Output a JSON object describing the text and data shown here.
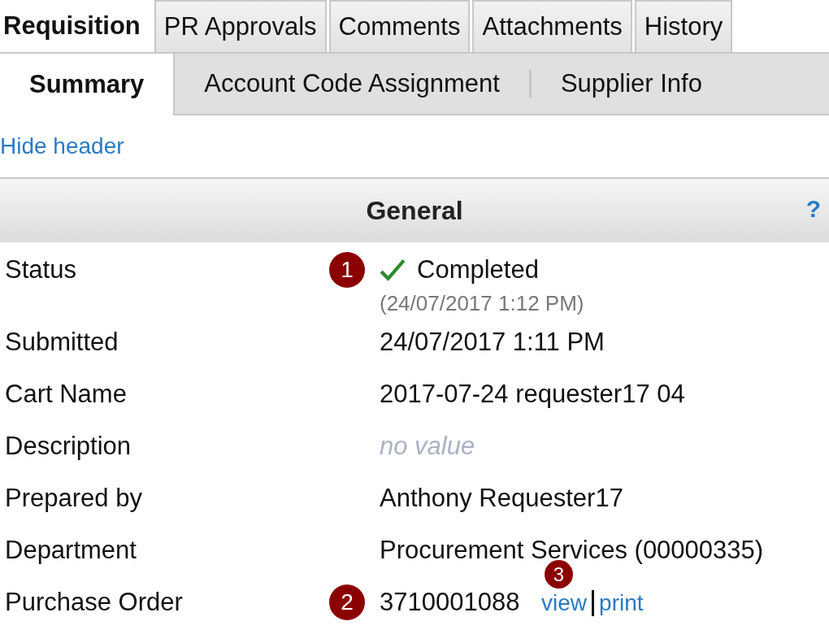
{
  "tabs": [
    {
      "label": "Requisition",
      "selected": true
    },
    {
      "label": "PR Approvals",
      "selected": false
    },
    {
      "label": "Comments",
      "selected": false
    },
    {
      "label": "Attachments",
      "selected": false
    },
    {
      "label": "History",
      "selected": false
    }
  ],
  "subtabs": [
    {
      "label": "Summary",
      "selected": true
    },
    {
      "label": "Account Code Assignment",
      "selected": false
    },
    {
      "label": "Supplier Info",
      "selected": false
    }
  ],
  "hide_header": "Hide header",
  "section": {
    "title": "General",
    "help": "?"
  },
  "rows": [
    {
      "kind": "status",
      "label": "Status",
      "badge": "1",
      "value": "Completed",
      "note": "(24/07/2017 1:12 PM)"
    },
    {
      "kind": "text",
      "label": "Submitted",
      "value": "24/07/2017 1:11 PM"
    },
    {
      "kind": "text",
      "label": "Cart Name",
      "value": "2017-07-24 requester17 04"
    },
    {
      "kind": "empty",
      "label": "Description",
      "value": "no value"
    },
    {
      "kind": "text",
      "label": "Prepared by",
      "value": "Anthony Requester17"
    },
    {
      "kind": "text",
      "label": "Department",
      "value": "Procurement Services (00000335)"
    },
    {
      "kind": "links",
      "label": "Purchase Order",
      "badge": "2",
      "value": "3710001088",
      "links": [
        {
          "label": "view",
          "badge": "3"
        },
        {
          "label": "print"
        }
      ]
    }
  ]
}
